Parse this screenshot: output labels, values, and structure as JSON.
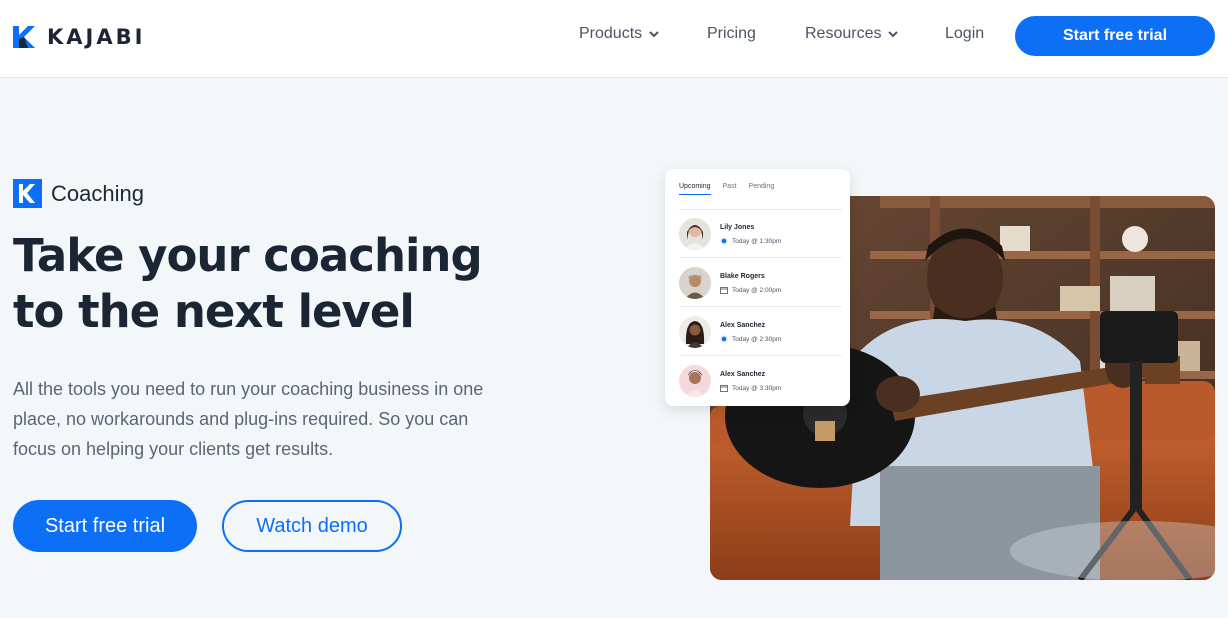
{
  "header": {
    "brand": "KAJABI",
    "nav": {
      "products": "Products",
      "pricing": "Pricing",
      "resources": "Resources",
      "login": "Login"
    },
    "cta": "Start free trial"
  },
  "hero": {
    "badge": "Coaching",
    "headline_line1": "Take your coaching",
    "headline_line2": "to the next level",
    "description": "All the tools you need to run your coaching business in one place, no workarounds and plug-ins required. So you can focus on helping your clients get results.",
    "primary_button": "Start free trial",
    "secondary_button": "Watch demo"
  },
  "schedule_card": {
    "tabs": [
      "Upcoming",
      "Past",
      "Pending"
    ],
    "appointments": [
      {
        "name": "Lily Jones",
        "time": "Today @ 1:30pm",
        "icon": "radio-dot-icon"
      },
      {
        "name": "Blake Rogers",
        "time": "Today @ 2:00pm",
        "icon": "calendar-icon"
      },
      {
        "name": "Alex Sanchez",
        "time": "Today @ 2:30pm",
        "icon": "radio-dot-icon"
      },
      {
        "name": "Alex Sanchez",
        "time": "Today @ 3:30pm",
        "icon": "calendar-icon"
      }
    ]
  },
  "colors": {
    "accent": "#0c6ff5",
    "background": "#f4f7fa",
    "text_dark": "#1b2533"
  }
}
